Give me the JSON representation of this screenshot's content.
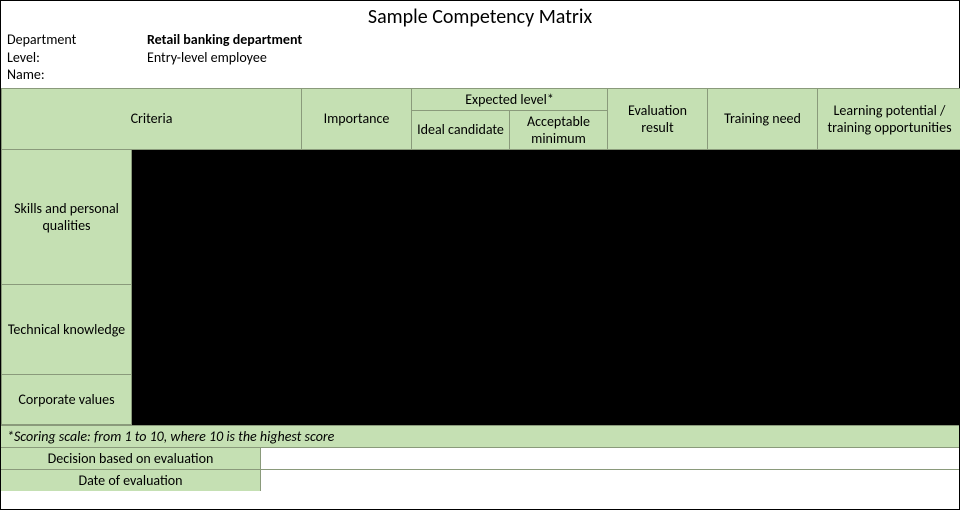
{
  "title": "Sample Competency Matrix",
  "info": {
    "department_label": "Department",
    "department_value": "Retail banking department",
    "level_label": "Level:",
    "level_value": "Entry-level employee",
    "name_label": "Name:",
    "name_value": ""
  },
  "headers": {
    "criteria": "Criteria",
    "importance": "Importance",
    "expected_level": "Expected level*",
    "ideal": "Ideal candidate",
    "acceptable": "Acceptable minimum",
    "evaluation": "Evaluation result",
    "training_need": "Training need",
    "learning_potential": "Learning potential / training opportunities"
  },
  "categories": {
    "skills": "Skills and personal qualities",
    "technical": "Technical knowledge",
    "corporate": "Corporate values"
  },
  "footnote": "*Scoring scale: from 1 to 10, where 10 is the highest score",
  "footer": {
    "decision_label": "Decision based on evaluation",
    "decision_value": "",
    "date_label": "Date of evaluation",
    "date_value": ""
  },
  "colors": {
    "header_bg": "#c5e0b3",
    "body_bg": "#000000"
  }
}
